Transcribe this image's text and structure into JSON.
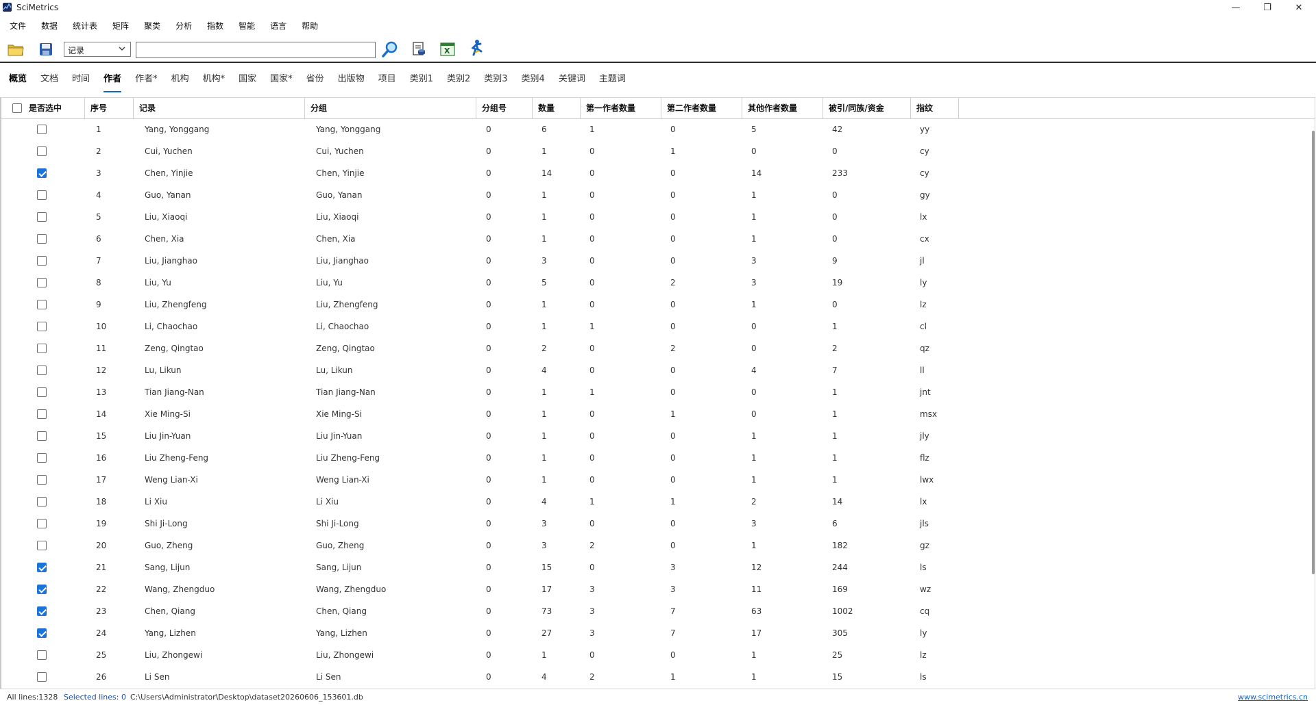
{
  "window": {
    "title": "SciMetrics",
    "minimize_glyph": "—",
    "restore_glyph": "❐",
    "close_glyph": "✕"
  },
  "menu": [
    "文件",
    "数据",
    "统计表",
    "矩阵",
    "聚类",
    "分析",
    "指数",
    "智能",
    "语言",
    "帮助"
  ],
  "toolbar": {
    "icons": [
      "open-folder-icon",
      "save-icon",
      "search-magnifier-icon",
      "document-db-icon",
      "excel-export-icon",
      "runner-icon"
    ],
    "field_select_value": "记录",
    "search_value": "",
    "search_placeholder": ""
  },
  "tabs": [
    "概览",
    "文档",
    "时间",
    "作者",
    "作者*",
    "机构",
    "机构*",
    "国家",
    "国家*",
    "省份",
    "出版物",
    "项目",
    "类别1",
    "类别2",
    "类别3",
    "类别4",
    "关键词",
    "主题词"
  ],
  "active_tab": "作者",
  "table": {
    "columns": [
      "是否选中",
      "序号",
      "记录",
      "分组",
      "分组号",
      "数量",
      "第一作者数量",
      "第二作者数量",
      "其他作者数量",
      "被引/同族/资金",
      "指纹"
    ],
    "rows": [
      {
        "checked": false,
        "no": "1",
        "record": "Yang, Yonggang",
        "group": "Yang, Yonggang",
        "group_no": "0",
        "count": "6",
        "first": "1",
        "second": "0",
        "other": "5",
        "cited": "42",
        "fp": "yy"
      },
      {
        "checked": false,
        "no": "2",
        "record": "Cui, Yuchen",
        "group": "Cui, Yuchen",
        "group_no": "0",
        "count": "1",
        "first": "0",
        "second": "1",
        "other": "0",
        "cited": "0",
        "fp": "cy"
      },
      {
        "checked": true,
        "no": "3",
        "record": "Chen, Yinjie",
        "group": "Chen, Yinjie",
        "group_no": "0",
        "count": "14",
        "first": "0",
        "second": "0",
        "other": "14",
        "cited": "233",
        "fp": "cy"
      },
      {
        "checked": false,
        "no": "4",
        "record": "Guo, Yanan",
        "group": "Guo, Yanan",
        "group_no": "0",
        "count": "1",
        "first": "0",
        "second": "0",
        "other": "1",
        "cited": "0",
        "fp": "gy"
      },
      {
        "checked": false,
        "no": "5",
        "record": "Liu, Xiaoqi",
        "group": "Liu, Xiaoqi",
        "group_no": "0",
        "count": "1",
        "first": "0",
        "second": "0",
        "other": "1",
        "cited": "0",
        "fp": "lx"
      },
      {
        "checked": false,
        "no": "6",
        "record": "Chen, Xia",
        "group": "Chen, Xia",
        "group_no": "0",
        "count": "1",
        "first": "0",
        "second": "0",
        "other": "1",
        "cited": "0",
        "fp": "cx"
      },
      {
        "checked": false,
        "no": "7",
        "record": "Liu, Jianghao",
        "group": "Liu, Jianghao",
        "group_no": "0",
        "count": "3",
        "first": "0",
        "second": "0",
        "other": "3",
        "cited": "9",
        "fp": "jl"
      },
      {
        "checked": false,
        "no": "8",
        "record": "Liu, Yu",
        "group": "Liu, Yu",
        "group_no": "0",
        "count": "5",
        "first": "0",
        "second": "2",
        "other": "3",
        "cited": "19",
        "fp": "ly"
      },
      {
        "checked": false,
        "no": "9",
        "record": "Liu, Zhengfeng",
        "group": "Liu, Zhengfeng",
        "group_no": "0",
        "count": "1",
        "first": "0",
        "second": "0",
        "other": "1",
        "cited": "0",
        "fp": "lz"
      },
      {
        "checked": false,
        "no": "10",
        "record": "Li, Chaochao",
        "group": "Li, Chaochao",
        "group_no": "0",
        "count": "1",
        "first": "1",
        "second": "0",
        "other": "0",
        "cited": "1",
        "fp": "cl"
      },
      {
        "checked": false,
        "no": "11",
        "record": "Zeng, Qingtao",
        "group": "Zeng, Qingtao",
        "group_no": "0",
        "count": "2",
        "first": "0",
        "second": "2",
        "other": "0",
        "cited": "2",
        "fp": "qz"
      },
      {
        "checked": false,
        "no": "12",
        "record": "Lu, Likun",
        "group": "Lu, Likun",
        "group_no": "0",
        "count": "4",
        "first": "0",
        "second": "0",
        "other": "4",
        "cited": "7",
        "fp": "ll"
      },
      {
        "checked": false,
        "no": "13",
        "record": "Tian Jiang-Nan",
        "group": "Tian Jiang-Nan",
        "group_no": "0",
        "count": "1",
        "first": "1",
        "second": "0",
        "other": "0",
        "cited": "1",
        "fp": "jnt"
      },
      {
        "checked": false,
        "no": "14",
        "record": "Xie Ming-Si",
        "group": "Xie Ming-Si",
        "group_no": "0",
        "count": "1",
        "first": "0",
        "second": "1",
        "other": "0",
        "cited": "1",
        "fp": "msx"
      },
      {
        "checked": false,
        "no": "15",
        "record": "Liu Jin-Yuan",
        "group": "Liu Jin-Yuan",
        "group_no": "0",
        "count": "1",
        "first": "0",
        "second": "0",
        "other": "1",
        "cited": "1",
        "fp": "jly"
      },
      {
        "checked": false,
        "no": "16",
        "record": "Liu Zheng-Feng",
        "group": "Liu Zheng-Feng",
        "group_no": "0",
        "count": "1",
        "first": "0",
        "second": "0",
        "other": "1",
        "cited": "1",
        "fp": "flz"
      },
      {
        "checked": false,
        "no": "17",
        "record": "Weng Lian-Xi",
        "group": "Weng Lian-Xi",
        "group_no": "0",
        "count": "1",
        "first": "0",
        "second": "0",
        "other": "1",
        "cited": "1",
        "fp": "lwx"
      },
      {
        "checked": false,
        "no": "18",
        "record": "Li Xiu",
        "group": "Li Xiu",
        "group_no": "0",
        "count": "4",
        "first": "1",
        "second": "1",
        "other": "2",
        "cited": "14",
        "fp": "lx"
      },
      {
        "checked": false,
        "no": "19",
        "record": "Shi Ji-Long",
        "group": "Shi Ji-Long",
        "group_no": "0",
        "count": "3",
        "first": "0",
        "second": "0",
        "other": "3",
        "cited": "6",
        "fp": "jls"
      },
      {
        "checked": false,
        "no": "20",
        "record": "Guo, Zheng",
        "group": "Guo, Zheng",
        "group_no": "0",
        "count": "3",
        "first": "2",
        "second": "0",
        "other": "1",
        "cited": "182",
        "fp": "gz"
      },
      {
        "checked": true,
        "no": "21",
        "record": "Sang, Lijun",
        "group": "Sang, Lijun",
        "group_no": "0",
        "count": "15",
        "first": "0",
        "second": "3",
        "other": "12",
        "cited": "244",
        "fp": "ls"
      },
      {
        "checked": true,
        "no": "22",
        "record": "Wang, Zhengduo",
        "group": "Wang, Zhengduo",
        "group_no": "0",
        "count": "17",
        "first": "3",
        "second": "3",
        "other": "11",
        "cited": "169",
        "fp": "wz"
      },
      {
        "checked": true,
        "no": "23",
        "record": "Chen, Qiang",
        "group": "Chen, Qiang",
        "group_no": "0",
        "count": "73",
        "first": "3",
        "second": "7",
        "other": "63",
        "cited": "1002",
        "fp": "cq"
      },
      {
        "checked": true,
        "no": "24",
        "record": "Yang, Lizhen",
        "group": "Yang, Lizhen",
        "group_no": "0",
        "count": "27",
        "first": "3",
        "second": "7",
        "other": "17",
        "cited": "305",
        "fp": "ly"
      },
      {
        "checked": false,
        "no": "25",
        "record": "Liu, Zhongewi",
        "group": "Liu, Zhongewi",
        "group_no": "0",
        "count": "1",
        "first": "0",
        "second": "0",
        "other": "1",
        "cited": "25",
        "fp": "lz"
      },
      {
        "checked": false,
        "no": "26",
        "record": "Li Sen",
        "group": "Li Sen",
        "group_no": "0",
        "count": "4",
        "first": "2",
        "second": "1",
        "other": "1",
        "cited": "15",
        "fp": "ls"
      }
    ]
  },
  "status": {
    "all_lines": "All lines:1328",
    "selected_lines": "Selected lines: 0",
    "path": "C:\\Users\\Administrator\\Desktop\\dataset20260606_153601.db",
    "website": "www.scimetrics.cn"
  },
  "colors": {
    "accent": "#1565c0",
    "checkbox_checked": "#1a73d9",
    "toolbar_border": "#2b2b2b"
  }
}
